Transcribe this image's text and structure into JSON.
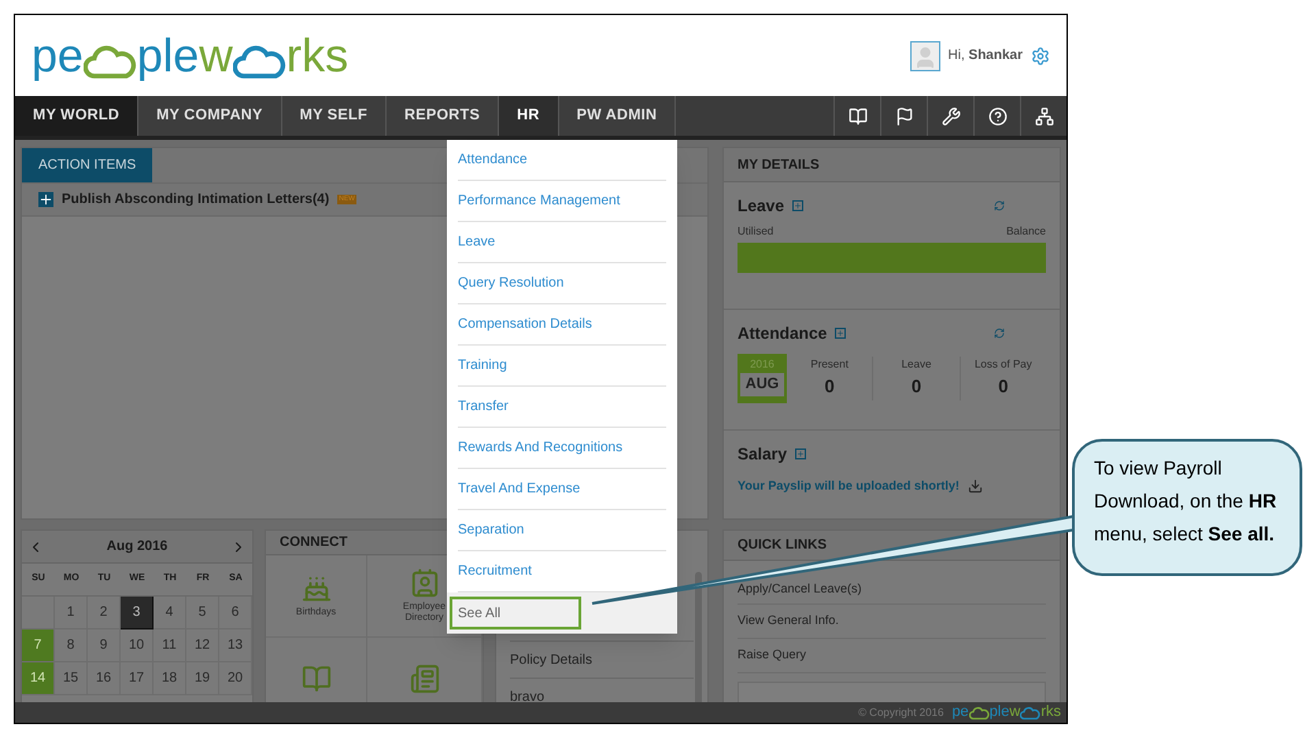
{
  "header": {
    "logo": [
      "pe",
      "plew",
      "rks"
    ],
    "greeting": "Hi, **Shankar**"
  },
  "nav": {
    "items": [
      {
        "label": "MY WORLD",
        "selected": true,
        "open": false
      },
      {
        "label": "MY COMPANY",
        "selected": false,
        "open": false
      },
      {
        "label": "MY SELF",
        "selected": false,
        "open": false
      },
      {
        "label": "REPORTS",
        "selected": false,
        "open": false
      },
      {
        "label": "HR",
        "selected": false,
        "open": true
      },
      {
        "label": "PW ADMIN",
        "selected": false,
        "open": false
      }
    ],
    "icons": [
      {
        "kind": "book"
      },
      {
        "kind": "flag"
      },
      {
        "kind": "tools"
      },
      {
        "kind": "help"
      },
      {
        "kind": "sitemap"
      }
    ]
  },
  "hr_menu": {
    "items": [
      {
        "label": "Attendance",
        "highlighted": false
      },
      {
        "label": "Performance Management",
        "highlighted": false
      },
      {
        "label": "Leave",
        "highlighted": false
      },
      {
        "label": "Query Resolution",
        "highlighted": false
      },
      {
        "label": "Compensation Details",
        "highlighted": false
      },
      {
        "label": "Training",
        "highlighted": false
      },
      {
        "label": "Transfer",
        "highlighted": false
      },
      {
        "label": "Rewards And Recognitions",
        "highlighted": false
      },
      {
        "label": "Travel And Expense",
        "highlighted": false
      },
      {
        "label": "Separation",
        "highlighted": false
      },
      {
        "label": "Recruitment",
        "highlighted": false
      },
      {
        "label": "See All",
        "highlighted": true
      }
    ]
  },
  "action_items": {
    "tab": "ACTION ITEMS",
    "rows": [
      {
        "title": "Publish Absconding Intimation Letters(4)",
        "badge": "NEW"
      }
    ]
  },
  "calendar": {
    "month": "Aug 2016",
    "weekdays": [
      "SU",
      "MO",
      "TU",
      "WE",
      "TH",
      "FR",
      "SA"
    ],
    "weeks": [
      [
        {
          "kind": "blank"
        },
        {
          "kind": "day",
          "day": "1"
        },
        {
          "kind": "day",
          "day": "2"
        },
        {
          "kind": "today",
          "day": "3"
        },
        {
          "kind": "day",
          "day": "4"
        },
        {
          "kind": "day",
          "day": "5"
        },
        {
          "kind": "day",
          "day": "6"
        }
      ],
      [
        {
          "kind": "holiday",
          "day": "7"
        },
        {
          "kind": "day",
          "day": "8"
        },
        {
          "kind": "day",
          "day": "9"
        },
        {
          "kind": "day",
          "day": "10"
        },
        {
          "kind": "day",
          "day": "11"
        },
        {
          "kind": "day",
          "day": "12"
        },
        {
          "kind": "day",
          "day": "13"
        }
      ],
      [
        {
          "kind": "holiday",
          "day": "14"
        },
        {
          "kind": "day",
          "day": "15"
        },
        {
          "kind": "day",
          "day": "16"
        },
        {
          "kind": "day",
          "day": "17"
        },
        {
          "kind": "day",
          "day": "18"
        },
        {
          "kind": "day",
          "day": "19"
        },
        {
          "kind": "day",
          "day": "20"
        }
      ]
    ]
  },
  "connect": {
    "title": "CONNECT",
    "tiles": [
      {
        "kind": "cake",
        "label": "Birthdays"
      },
      {
        "kind": "contact",
        "label": "Employee Directory"
      },
      {
        "kind": "book"
      },
      {
        "kind": "news"
      }
    ]
  },
  "middle_list": {
    "items": [
      "Policy Details",
      "bravo"
    ]
  },
  "my_details": {
    "title": "MY DETAILS",
    "leave": {
      "title": "Leave",
      "left_label": "Utilised",
      "right_label": "Balance"
    },
    "attendance": {
      "title": "Attendance",
      "year": "2016",
      "month": "AUG",
      "stats": [
        {
          "label": "Present",
          "value": "0"
        },
        {
          "label": "Leave",
          "value": "0"
        },
        {
          "label": "Loss of Pay",
          "value": "0"
        }
      ]
    },
    "salary": {
      "title": "Salary",
      "message": "Your Payslip will be uploaded shortly!"
    }
  },
  "quick_links": {
    "title": "QUICK LINKS",
    "items": [
      "Apply/Cancel Leave(s)",
      "View General Info.",
      "Raise Query"
    ]
  },
  "footer": {
    "copyright": "© Copyright 2016",
    "logo": [
      "pe",
      "plew",
      "rks"
    ]
  },
  "callout": {
    "text": "To view Payroll Download, on the **HR** menu, select **See all.**"
  }
}
